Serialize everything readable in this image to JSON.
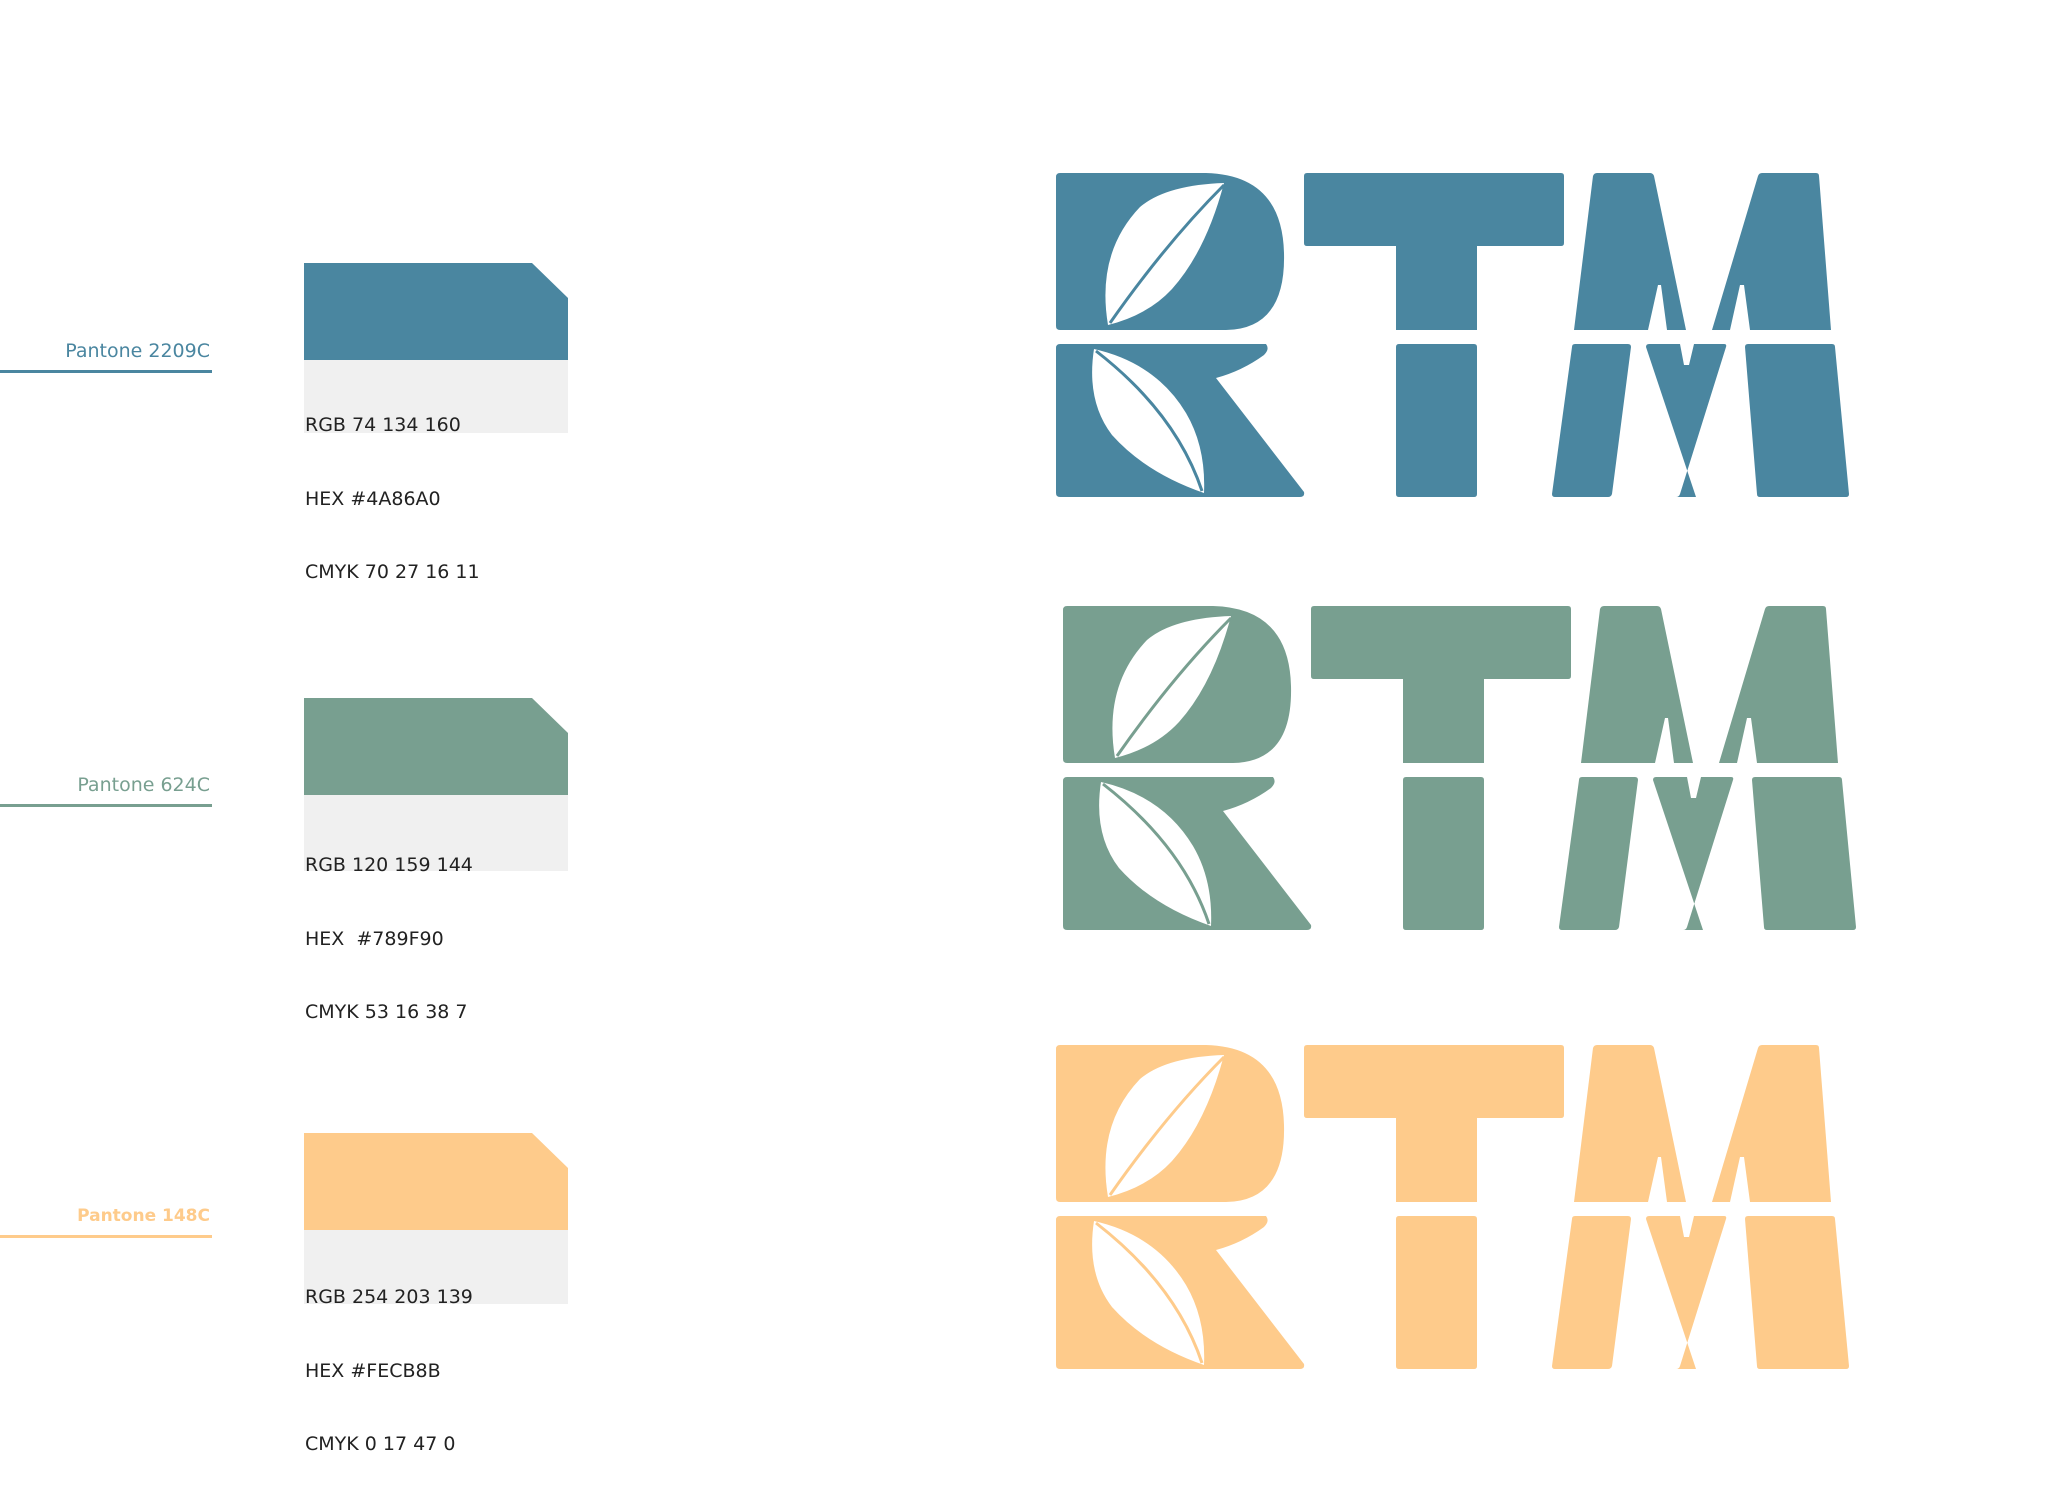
{
  "swatches": [
    {
      "pantone": "Pantone 2209C",
      "color": "#4A86A0",
      "rgb": "RGB 74 134 160",
      "hex": "HEX #4A86A0",
      "cmyk": "CMYK 70 27 16 11",
      "logo_text": "RTM"
    },
    {
      "pantone": "Pantone 624C",
      "color": "#789F90",
      "rgb": "RGB 120 159 144",
      "hex": "HEX  #789F90",
      "cmyk": "CMYK 53 16 38 7",
      "logo_text": "RTM"
    },
    {
      "pantone": "Pantone 148C",
      "color": "#FECB8B",
      "rgb": "RGB 254 203 139",
      "hex": "HEX #FECB8B",
      "cmyk": "CMYK 0 17 47 0",
      "logo_text": "RTM"
    }
  ]
}
